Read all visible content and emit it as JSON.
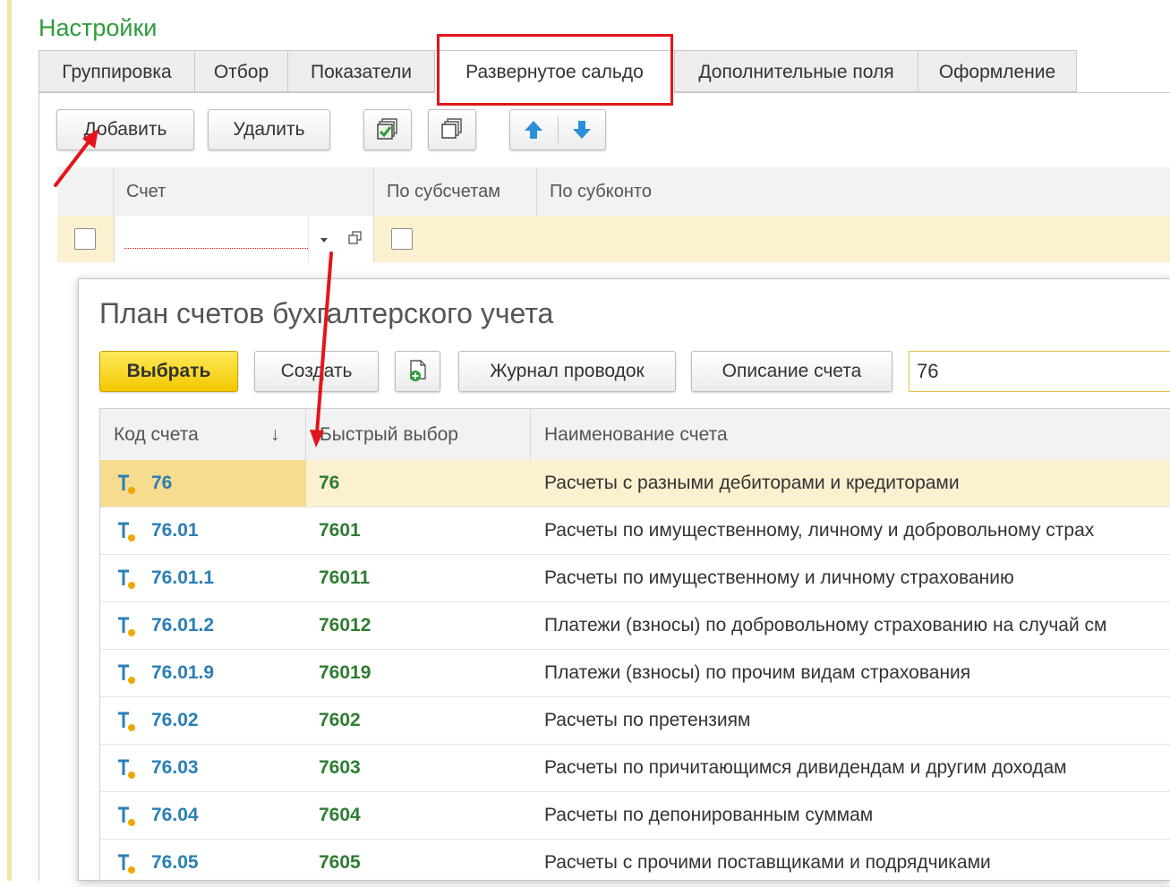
{
  "settings": {
    "title": "Настройки"
  },
  "tabs": {
    "grouping": "Группировка",
    "filter": "Отбор",
    "indicators": "Показатели",
    "expanded_balance": "Развернутое сальдо",
    "extra_fields": "Дополнительные поля",
    "design": "Оформление",
    "active": "Развернутое сальдо"
  },
  "toolbar": {
    "add": "Добавить",
    "delete": "Удалить"
  },
  "grid1": {
    "columns": {
      "account": "Счет",
      "by_subaccounts": "По субсчетам",
      "by_subconto": "По субконто"
    }
  },
  "dialog": {
    "title": "План счетов бухгалтерского учета",
    "select": "Выбрать",
    "create": "Создать",
    "journal": "Журнал проводок",
    "description": "Описание счета",
    "search_value": "76",
    "columns": {
      "code": "Код счета",
      "sort_arrow": "↓",
      "quick": "Быстрый выбор",
      "name": "Наименование счета"
    },
    "rows": [
      {
        "code": "76",
        "quick": "76",
        "name": "Расчеты с разными дебиторами и кредиторами",
        "selected": true
      },
      {
        "code": "76.01",
        "quick": "7601",
        "name": "Расчеты по имущественному, личному и добровольному страх"
      },
      {
        "code": "76.01.1",
        "quick": "76011",
        "name": "Расчеты по имущественному и личному страхованию"
      },
      {
        "code": "76.01.2",
        "quick": "76012",
        "name": "Платежи (взносы) по добровольному страхованию на случай см"
      },
      {
        "code": "76.01.9",
        "quick": "76019",
        "name": "Платежи (взносы) по прочим видам страхования"
      },
      {
        "code": "76.02",
        "quick": "7602",
        "name": "Расчеты по претензиям"
      },
      {
        "code": "76.03",
        "quick": "7603",
        "name": "Расчеты по причитающимся дивидендам и другим доходам"
      },
      {
        "code": "76.04",
        "quick": "7604",
        "name": "Расчеты по депонированным суммам"
      },
      {
        "code": "76.05",
        "quick": "7605",
        "name": "Расчеты с прочими поставщиками и подрядчиками"
      }
    ]
  },
  "colors": {
    "accent_green": "#2e9b3a",
    "highlight_red": "#e3151b",
    "selected_row": "#fbf0cf"
  }
}
